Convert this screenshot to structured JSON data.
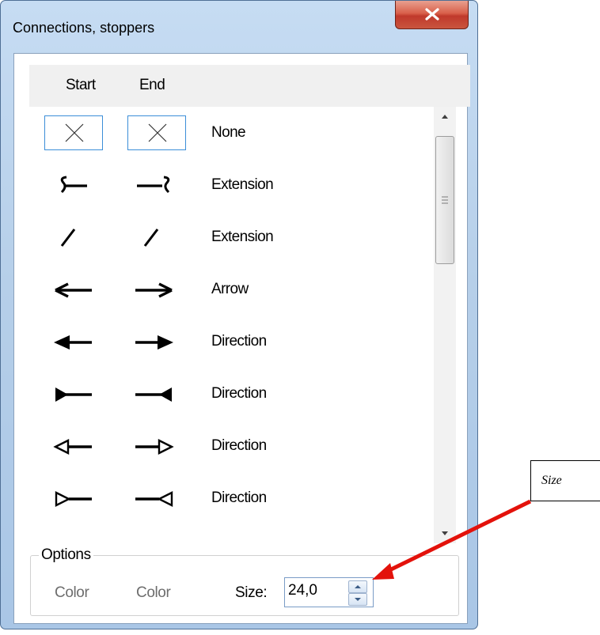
{
  "window": {
    "title": "Connections, stoppers"
  },
  "header": {
    "start_label": "Start",
    "end_label": "End"
  },
  "rows": [
    {
      "label": "None",
      "start_icon": "x-none-icon",
      "end_icon": "x-none-icon"
    },
    {
      "label": "Extension",
      "start_icon": "hook-extension-start-icon",
      "end_icon": "hook-extension-end-icon"
    },
    {
      "label": "Extension",
      "start_icon": "slash-extension-icon",
      "end_icon": "slash-extension-icon"
    },
    {
      "label": "Arrow",
      "start_icon": "arrow-left-open-icon",
      "end_icon": "arrow-right-open-icon"
    },
    {
      "label": "Direction",
      "start_icon": "filled-arrow-left-icon",
      "end_icon": "filled-arrow-right-icon"
    },
    {
      "label": "Direction",
      "start_icon": "filled-triangle-tail-left-icon",
      "end_icon": "filled-triangle-tail-right-icon"
    },
    {
      "label": "Direction",
      "start_icon": "hollow-arrow-left-icon",
      "end_icon": "hollow-arrow-right-icon"
    },
    {
      "label": "Direction",
      "start_icon": "hollow-triangle-tail-left-icon",
      "end_icon": "hollow-triangle-tail-right-icon"
    }
  ],
  "options": {
    "legend": "Options",
    "start_color_label": "Color",
    "end_color_label": "Color",
    "size_label": "Size:",
    "size_value": "24,0"
  },
  "callout": {
    "text": "Size"
  },
  "colors": {
    "selection_border": "#3b8ed8",
    "callout_arrow": "#e3120b",
    "close_button": "#c0392b"
  }
}
